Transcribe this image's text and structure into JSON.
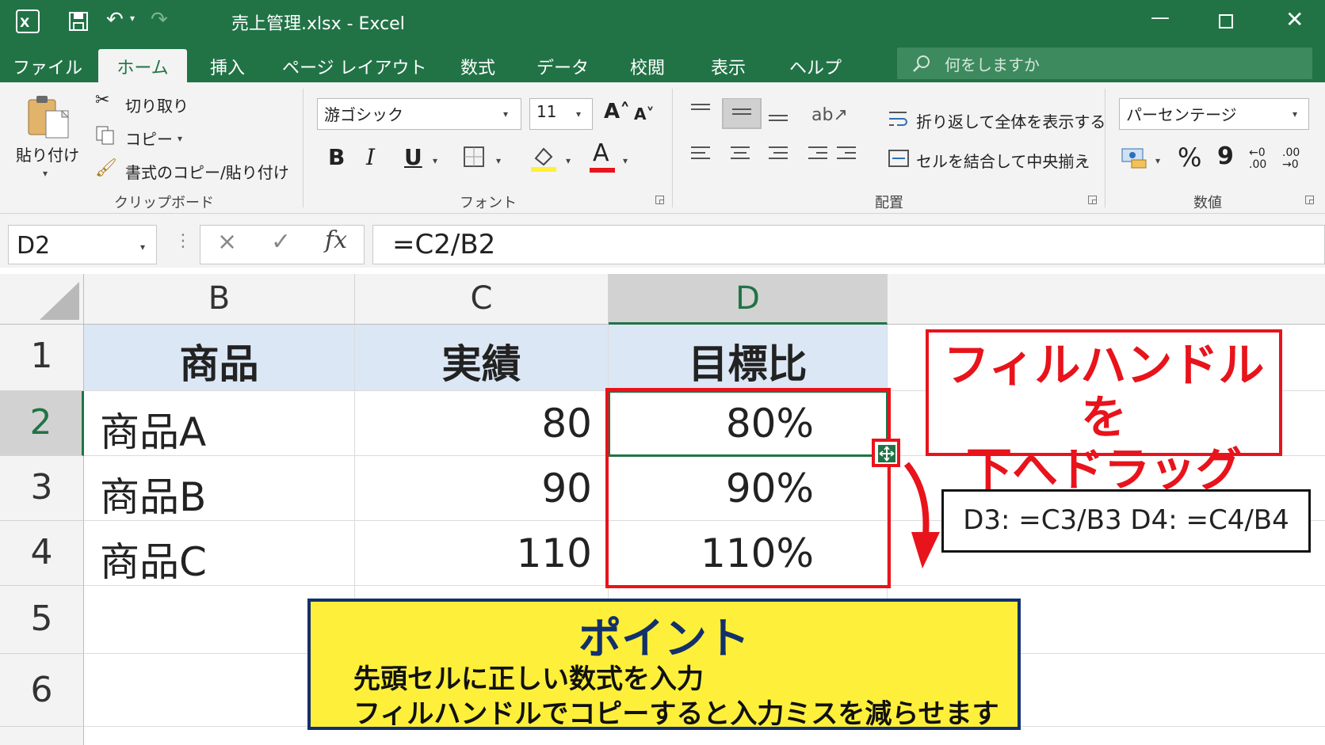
{
  "app": {
    "window_title": "売上管理.xlsx  -  Excel"
  },
  "tabs": [
    "ファイル",
    "ホーム",
    "挿入",
    "ページ レイアウト",
    "数式",
    "データ",
    "校閲",
    "表示",
    "ヘルプ"
  ],
  "active_tab": "ホーム",
  "search": {
    "placeholder": "何をしますか"
  },
  "ribbon": {
    "clipboard": {
      "paste": "貼り付け",
      "cut": "切り取り",
      "copy": "コピー",
      "format_painter": "書式のコピー/貼り付け",
      "group_label": "クリップボード"
    },
    "font": {
      "font_name": "游ゴシック",
      "font_size": "11",
      "bold": "B",
      "italic": "I",
      "underline": "U",
      "font_color": "A",
      "group_label": "フォント"
    },
    "alignment": {
      "wrap_text": "折り返して全体を表示する",
      "merge_center": "セルを結合して中央揃え",
      "group_label": "配置"
    },
    "number": {
      "format": "パーセンテージ",
      "percent": "%",
      "comma": "9",
      "inc_decimal": "←0 .00",
      "dec_decimal": ".00 →0",
      "group_label": "数値"
    }
  },
  "formula_bar": {
    "name_box": "D2",
    "cancel": "×",
    "enter": "✓",
    "fx": "fx",
    "formula": "=C2/B2"
  },
  "sheet": {
    "columns": [
      "B",
      "C",
      "D"
    ],
    "rows": [
      "1",
      "2",
      "3",
      "4",
      "5",
      "6"
    ],
    "header": [
      "商品",
      "実績",
      "目標比"
    ],
    "data": [
      [
        "商品A",
        "80",
        "80%"
      ],
      [
        "商品B",
        "90",
        "90%"
      ],
      [
        "商品C",
        "110",
        "110%"
      ]
    ]
  },
  "callouts": {
    "fill_handle_line1": "フィルハンドルを",
    "fill_handle_line2": "下へドラッグ",
    "formula_note": "D3: =C3/B3   D4: =C4/B4",
    "point_title": "ポイント",
    "point_line1": "先頭セルに正しい数式を入力",
    "point_line2": "フィルハンドルでコピーすると入力ミスを減らせます"
  },
  "colors": {
    "excel_green": "#217346",
    "header_fill": "#dbe7f4",
    "highlight_red": "#e8131b",
    "point_yellow": "#fef03a",
    "point_border": "#13306b"
  }
}
